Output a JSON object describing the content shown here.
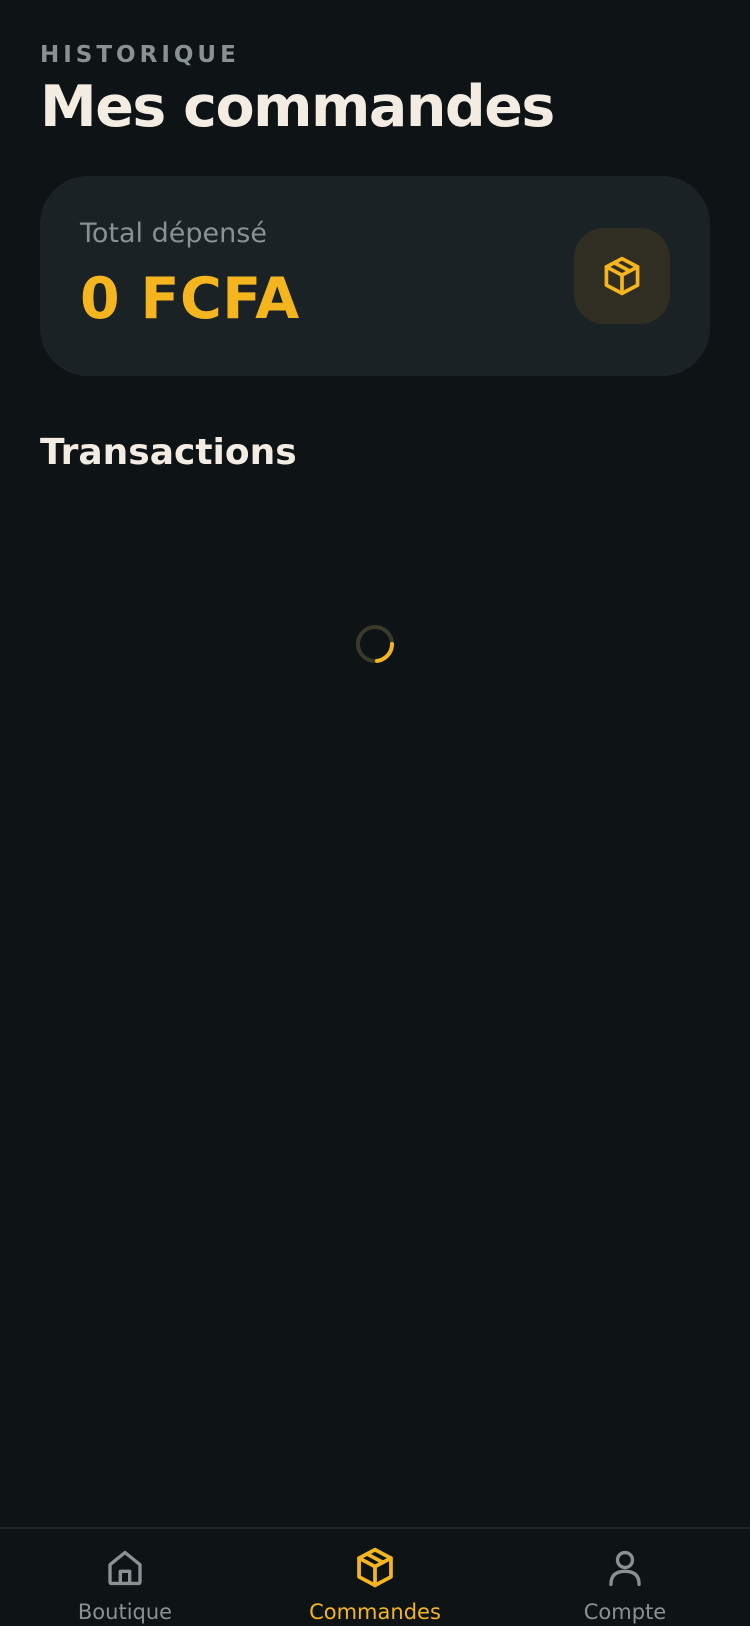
{
  "header": {
    "eyebrow": "HISTORIQUE",
    "title": "Mes commandes"
  },
  "summary": {
    "label": "Total dépensé",
    "value": "0 FCFA",
    "icon": "package-icon"
  },
  "transactions": {
    "title": "Transactions",
    "loading": true
  },
  "tabbar": {
    "tabs": [
      {
        "label": "Boutique",
        "icon": "home-icon",
        "active": false
      },
      {
        "label": "Commandes",
        "icon": "package-icon",
        "active": true
      },
      {
        "label": "Compte",
        "icon": "user-icon",
        "active": false
      }
    ]
  },
  "colors": {
    "background": "#0e1316",
    "card": "#1a2226",
    "accent": "#f5b51e",
    "text": "#f3ece3",
    "muted": "#8a9193"
  }
}
